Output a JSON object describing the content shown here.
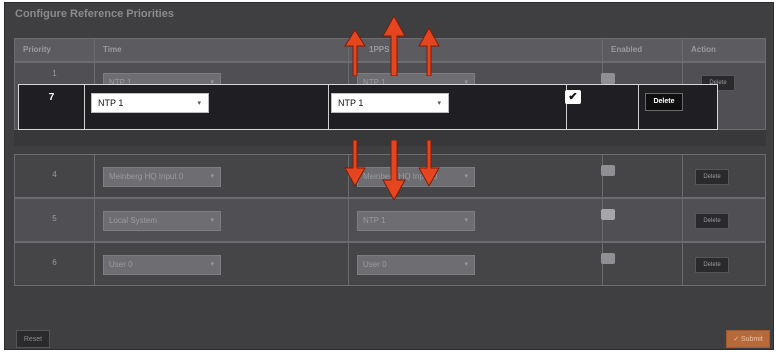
{
  "dialog": {
    "title": "Configure Reference Priorities"
  },
  "table": {
    "headers": [
      "Priority",
      "Time",
      "1PPS",
      "Enabled",
      "Action"
    ],
    "background_rows": [
      {
        "priority": "1",
        "time": "NTP 1",
        "pps": "NTP 1",
        "enabled": true,
        "action": "Delete"
      },
      {
        "priority": "4",
        "time": "Meinberg HQ Input 0",
        "pps": "Meinberg HQ Input 0",
        "enabled": true,
        "action": "Delete"
      },
      {
        "priority": "5",
        "time": "Local System",
        "pps": "NTP 1",
        "enabled": false,
        "action": "Delete"
      },
      {
        "priority": "6",
        "time": "User 0",
        "pps": "User 0",
        "enabled": true,
        "action": "Delete"
      }
    ]
  },
  "highlighted_row": {
    "priority": "7",
    "time": "NTP 1",
    "pps": "NTP 1",
    "enabled_glyph": "✔",
    "delete_label": "Delete"
  },
  "footer": {
    "reset_label": "Reset",
    "submit_label": "✓ Submit"
  },
  "icons": {
    "caret": "▾"
  },
  "colors": {
    "arrow": "#e5461f",
    "submit": "#b8693a"
  }
}
